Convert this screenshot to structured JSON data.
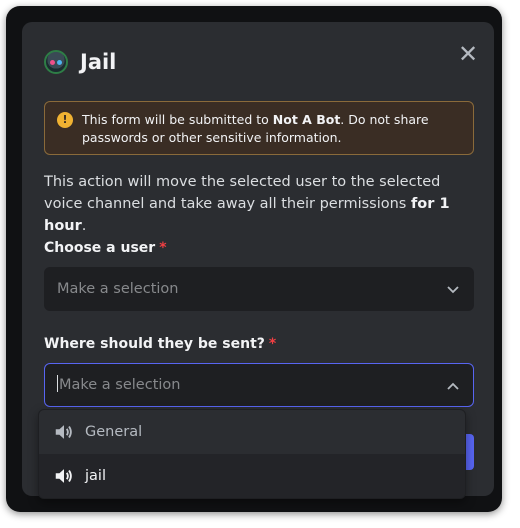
{
  "modal": {
    "title": "Jail",
    "close_icon": "close-icon",
    "app_icon": "bot-avatar-icon"
  },
  "warning": {
    "icon": "warning-icon",
    "icon_glyph": "!",
    "prefix": "This form will be submitted to ",
    "bot_name": "Not A Bot",
    "suffix": ". Do not share passwords or other sensitive information."
  },
  "description": {
    "text": "This action will move the selected user to the selected voice channel and take away all their permissions ",
    "emphasis": "for 1 hour",
    "end": "."
  },
  "fields": [
    {
      "label": "Choose a user",
      "required": "*",
      "placeholder": "Make a selection",
      "state": "closed"
    },
    {
      "label": "Where should they be sent?",
      "required": "*",
      "placeholder": "Make a selection",
      "state": "open"
    }
  ],
  "dropdown": {
    "options": [
      {
        "label": "General",
        "icon": "speaker-icon"
      },
      {
        "label": "jail",
        "icon": "speaker-icon"
      }
    ]
  },
  "colors": {
    "accent": "#5865f2",
    "warning": "#f0b232",
    "required": "#f23f43",
    "background": "#2b2d31"
  }
}
